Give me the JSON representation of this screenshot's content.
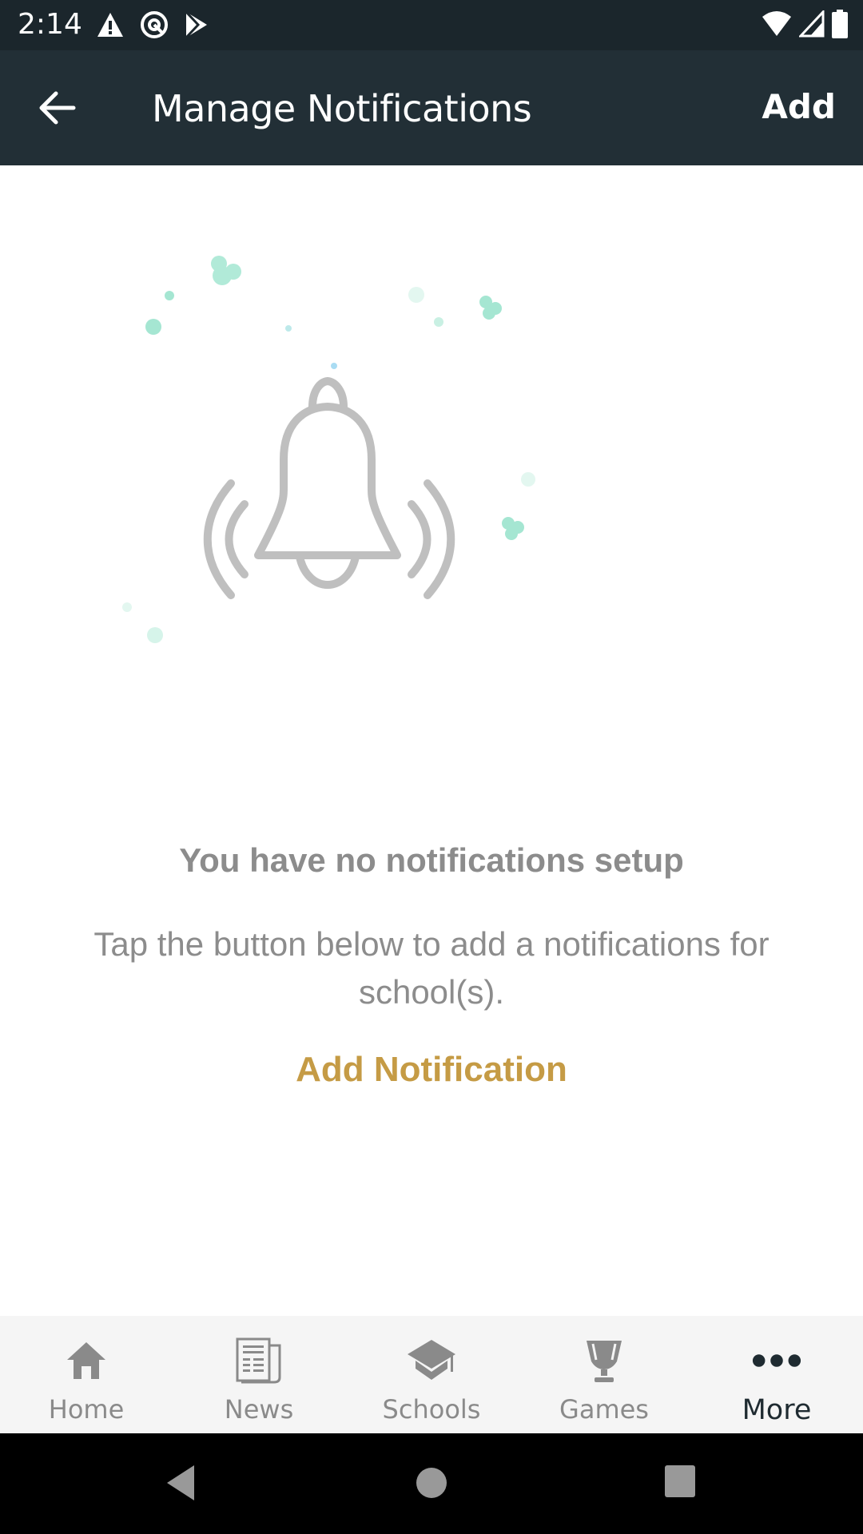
{
  "status_bar": {
    "time": "2:14",
    "left_icons": [
      "alert-icon",
      "at-sign-icon",
      "play-store-icon"
    ],
    "right_icons": [
      "wifi-icon",
      "cell-signal-icon",
      "battery-icon"
    ]
  },
  "app_bar": {
    "back_icon": "arrow-left-icon",
    "title": "Manage Notifications",
    "action_label": "Add"
  },
  "empty_state": {
    "illustration": "ringing-bell-icon",
    "title": "You have no notifications setup",
    "description": "Tap the button below to add a notifications for school(s).",
    "action_label": "Add Notification"
  },
  "bottom_nav": {
    "items": [
      {
        "label": "Home",
        "icon": "home-icon",
        "active": false
      },
      {
        "label": "News",
        "icon": "newspaper-icon",
        "active": false
      },
      {
        "label": "Schools",
        "icon": "graduation-cap-icon",
        "active": false
      },
      {
        "label": "Games",
        "icon": "trophy-icon",
        "active": false
      },
      {
        "label": "More",
        "icon": "more-dots-icon",
        "active": true
      }
    ]
  },
  "system_nav": {
    "buttons": [
      "back-triangle-icon",
      "home-circle-icon",
      "recents-square-icon"
    ]
  },
  "colors": {
    "app_bar": "#222f36",
    "status_bar": "#1b262c",
    "accent": "#c59b45",
    "muted_text": "#8c8c8c",
    "sparkle": "#7fe0c3"
  }
}
